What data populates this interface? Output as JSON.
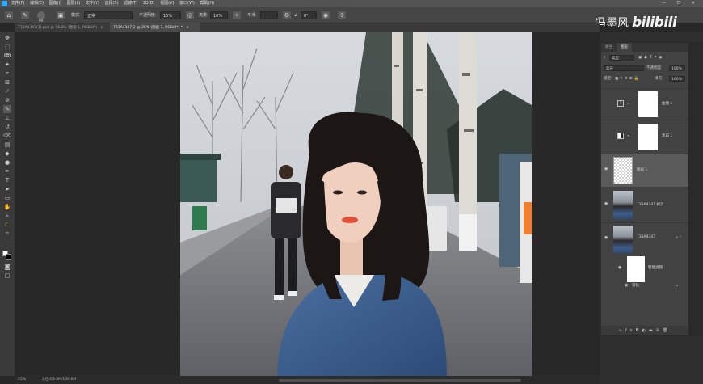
{
  "app": {
    "menu": [
      "文件(F)",
      "编辑(E)",
      "图像(I)",
      "图层(L)",
      "文字(Y)",
      "选择(S)",
      "滤镜(T)",
      "3D(D)",
      "视图(V)",
      "窗口(W)",
      "帮助(H)"
    ],
    "window_controls": "— ❐ ✕"
  },
  "options_bar": {
    "mode_label": "模式:",
    "mode_value": "正常",
    "opacity_label": "不透明度:",
    "opacity_value": "15%",
    "flow_label": "流量:",
    "flow_value": "10%",
    "smoothing_label": "平滑:",
    "angle_value": "0°",
    "brush_size": "99"
  },
  "tabs": [
    {
      "label": "733A4347(1).psd @ 16.2% (图层 1, RGB/8*)",
      "close": "×"
    },
    {
      "label": "733A4347-2 @ 25% (图层 1, RGB/8*) *",
      "close": "×"
    }
  ],
  "layers_panel": {
    "tabs": [
      "路径",
      "图层"
    ],
    "filter_kind": "类型",
    "blend_mode": "柔光",
    "opacity_label": "不透明度:",
    "opacity_value": "100%",
    "lock_label": "锁定:",
    "fill_label": "填充:",
    "fill_value": "100%",
    "layers": [
      {
        "name": "曲线 1"
      },
      {
        "name": "黑白 1"
      },
      {
        "name": "图层 1"
      },
      {
        "name": "733A4347 拷贝"
      },
      {
        "name": "733A4347"
      },
      {
        "name": "智能滤镜"
      },
      {
        "name": "液化"
      }
    ]
  },
  "status": {
    "zoom": "25%",
    "doc": "文档:63.3M/106.6M"
  },
  "watermark": {
    "text": "冯墨风",
    "brand": "bilibili"
  }
}
